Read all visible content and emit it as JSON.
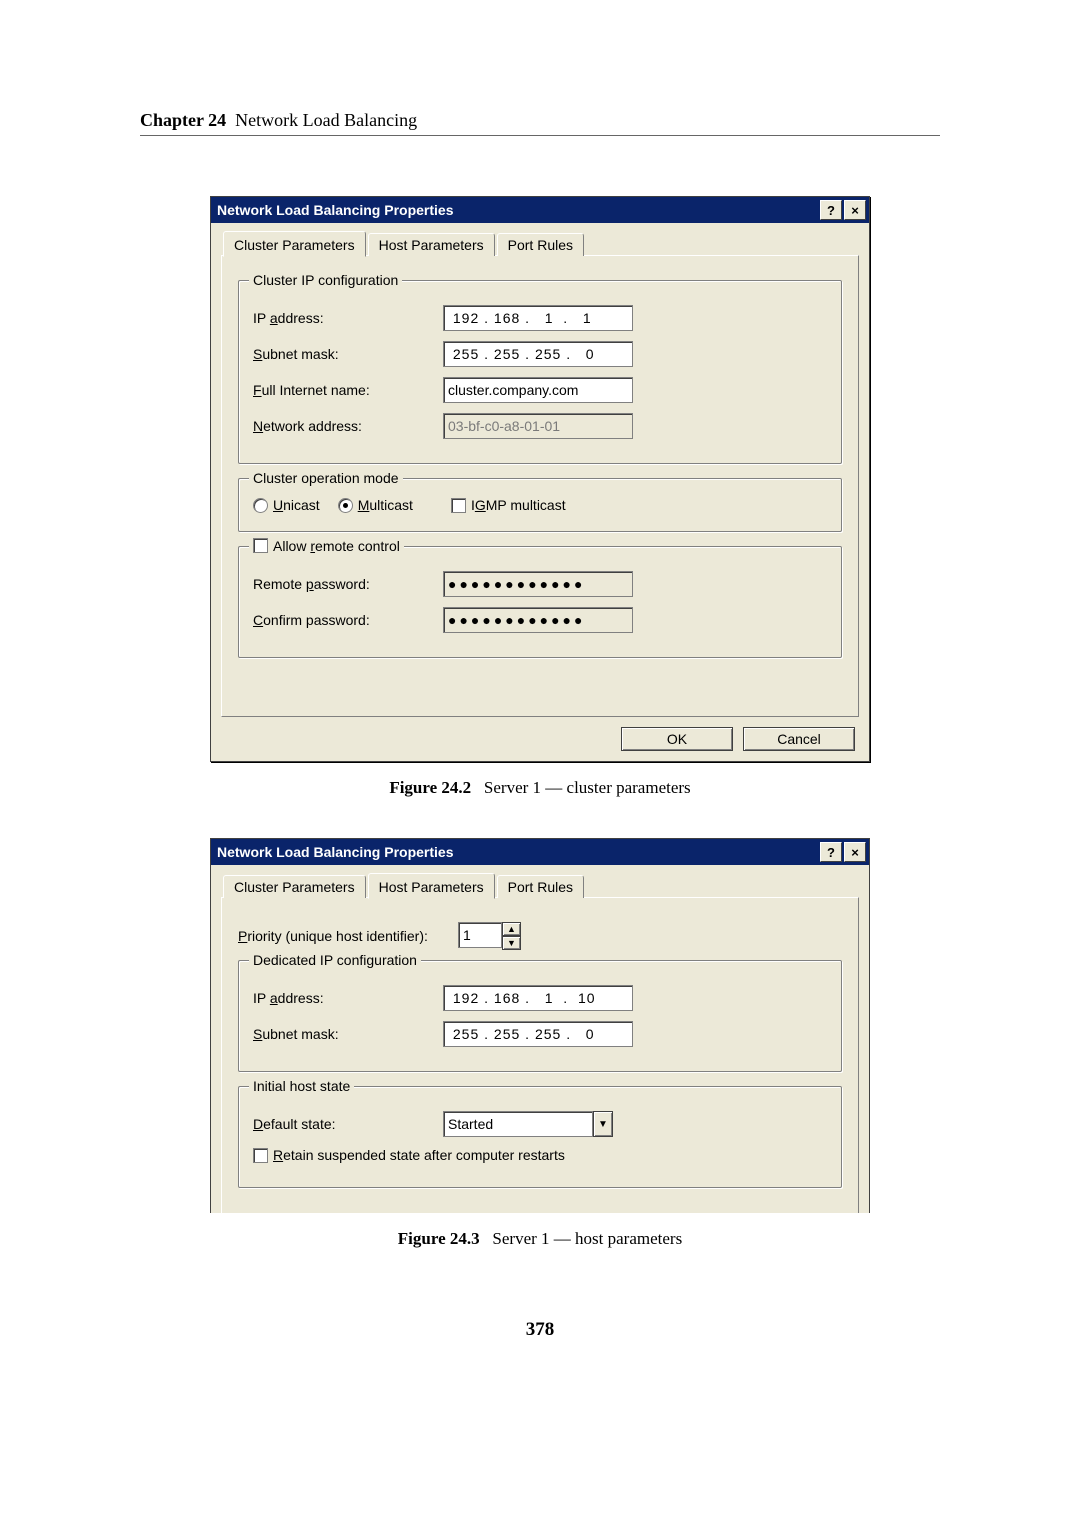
{
  "header": {
    "chapter": "Chapter 24",
    "title": "Network Load Balancing"
  },
  "pagenum": "378",
  "fig1": {
    "caption_bold": "Figure 24.2",
    "caption_rest": "Server 1 — cluster parameters",
    "window_title": "Network Load Balancing Properties",
    "tabs": {
      "cluster": "Cluster Parameters",
      "host": "Host Parameters",
      "port": "Port Rules"
    },
    "grp_ip": {
      "legend": "Cluster IP configuration",
      "ip_label": "IP address:",
      "ip_value": " 192 . 168 .   1  .   1",
      "subnet_label": "Subnet mask:",
      "subnet_value": " 255 . 255 . 255 .   0",
      "full_label": "Full Internet name:",
      "full_value": "cluster.company.com",
      "net_label": "Network address:",
      "net_value": "03-bf-c0-a8-01-01"
    },
    "grp_mode": {
      "legend": "Cluster operation mode",
      "unicast": "Unicast",
      "multicast": "Multicast",
      "igmp": "IGMP multicast"
    },
    "grp_remote": {
      "legend": "Allow remote control",
      "pwd_label": "Remote password:",
      "pwd_value": "●●●●●●●●●●●●",
      "cpwd_label": "Confirm password:",
      "cpwd_value": "●●●●●●●●●●●●"
    },
    "ok": "OK",
    "cancel": "Cancel"
  },
  "fig2": {
    "caption_bold": "Figure 24.3",
    "caption_rest": "Server 1 — host parameters",
    "window_title": "Network Load Balancing Properties",
    "tabs": {
      "cluster": "Cluster Parameters",
      "host": "Host Parameters",
      "port": "Port Rules"
    },
    "priority_label": "Priority (unique host identifier):",
    "priority_value": "1",
    "grp_ip": {
      "legend": "Dedicated IP configuration",
      "ip_label": "IP address:",
      "ip_value": " 192 . 168 .   1  .  10",
      "subnet_label": "Subnet mask:",
      "subnet_value": " 255 . 255 . 255 .   0"
    },
    "grp_state": {
      "legend": "Initial host state",
      "default_label": "Default state:",
      "default_value": "Started",
      "retain": "Retain suspended state after computer restarts"
    }
  }
}
